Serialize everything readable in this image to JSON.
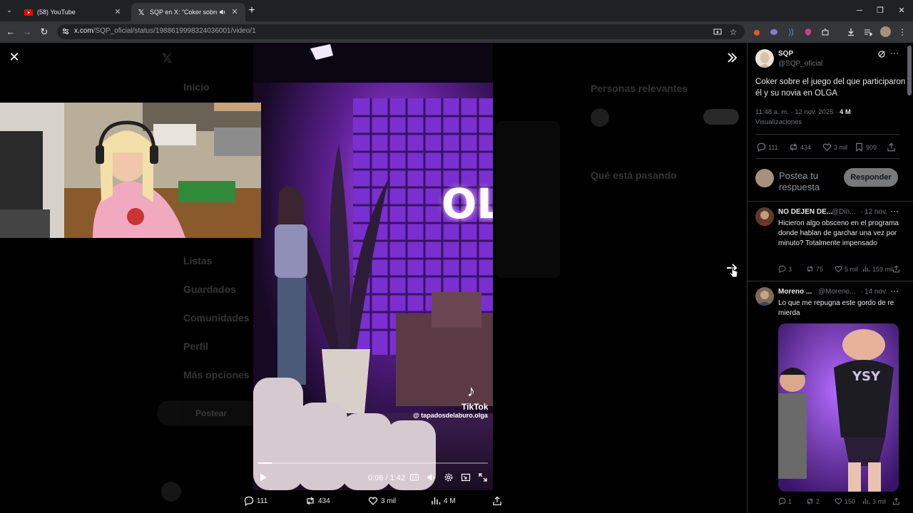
{
  "browser": {
    "tabs": [
      {
        "title": "(58) YouTube"
      },
      {
        "title": "SQP en X: \"Coker sobre el j"
      }
    ],
    "url_domain": "x.com",
    "url_path": "/SQP_oficial/status/1988619998324036001/video/1"
  },
  "video": {
    "time": "0:06 / 1:42",
    "progress_fraction": 0.06,
    "tiktok_brand": "TikTok",
    "tiktok_handle": "@ tapadosdelaburo.olga",
    "sign_text": "OL"
  },
  "actions": {
    "replies": "111",
    "reposts": "434",
    "likes": "3 mil",
    "views": "4 M"
  },
  "post": {
    "author_name": "SQP",
    "author_handle": "@SQP_oficial",
    "text": "Coker sobre el juego del que participaron él y su novia en OLGA",
    "timestamp": "11:48 a. m. · 12 nov. 2025 · ",
    "views": "4 M",
    "views_label": "Visualizaciones",
    "stats": {
      "replies": "111",
      "reposts": "434",
      "likes": "3 mil",
      "bookmarks": "909"
    }
  },
  "reply_box": {
    "placeholder": "Postea tu respuesta",
    "button": "Responder"
  },
  "replies": [
    {
      "name": "NO DEJEN DE...",
      "handle": "@Din...",
      "date": "· 12 nov.",
      "text": "Hicieron algo obsceno en el programa donde hablan de garchar una vez por minuto? Totalmente impensado",
      "stats": {
        "replies": "3",
        "reposts": "75",
        "likes": "5 mil",
        "views": "159 mil"
      }
    },
    {
      "name": "Moreno ...",
      "handle": "@Moreno...",
      "date": "· 14 nov.",
      "text": "Lo que me repugna este gordo de re mierda",
      "stats": {
        "replies": "1",
        "reposts": "2",
        "likes": "150",
        "views": "3 mil"
      }
    }
  ],
  "background_page": {
    "nav": [
      "Inicio",
      "Listas",
      "Guardados",
      "Comunidades",
      "Perfil",
      "Más opciones"
    ],
    "post_button": "Postear",
    "relevant_title": "Personas relevantes",
    "trending_title": "Qué está pasando"
  }
}
